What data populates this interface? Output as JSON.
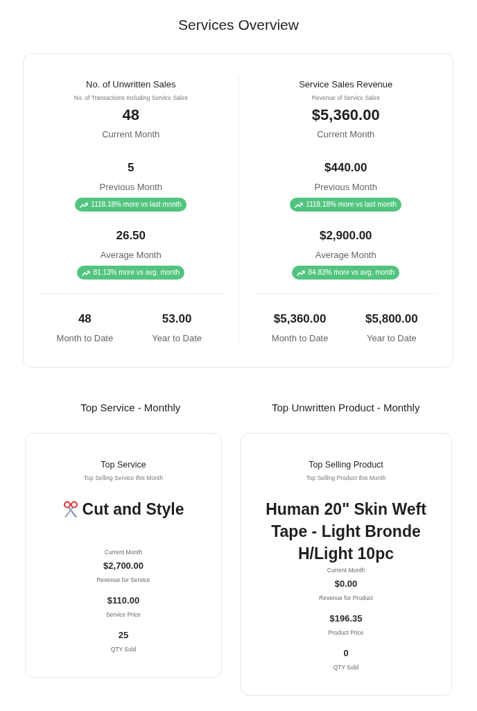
{
  "title": "Services Overview",
  "overview": {
    "panels": [
      {
        "title": "No. of Unwritten Sales",
        "subtitle": "No. of Transactions Including Service Sales",
        "current": {
          "value": "48",
          "label": "Current Month"
        },
        "comparisons": [
          {
            "value": "5",
            "label": "Previous Month",
            "badge": {
              "text": "1118.18% more vs last month",
              "rising": true
            }
          },
          {
            "value": "26.50",
            "label": "Average Month",
            "badge": {
              "text": "81.13% more vs avg. month",
              "rising": true
            }
          }
        ],
        "totals": [
          {
            "value": "48",
            "label": "Month to Date"
          },
          {
            "value": "53.00",
            "label": "Year to Date"
          }
        ]
      },
      {
        "title": "Service Sales Revenue",
        "subtitle": "Revenue of Service Sales",
        "current": {
          "value": "$5,360.00",
          "label": "Current Month"
        },
        "comparisons": [
          {
            "value": "$440.00",
            "label": "Previous Month",
            "badge": {
              "text": "1118.18% more vs last month",
              "rising": true
            }
          },
          {
            "value": "$2,900.00",
            "label": "Average Month",
            "badge": {
              "text": "84.83% more vs avg. month",
              "rising": true
            }
          }
        ],
        "totals": [
          {
            "value": "$5,360.00",
            "label": "Month to Date"
          },
          {
            "value": "$5,800.00",
            "label": "Year to Date"
          }
        ]
      }
    ]
  },
  "top_sections": [
    {
      "heading": "Top Service - Monthly",
      "card": {
        "kind": "service",
        "title": "Top Service",
        "subtitle": "Top Selling Service this Month",
        "name": "Cut and Style",
        "period": "Current Month",
        "stats": [
          {
            "value": "$2,700.00",
            "label": "Revenue for Service"
          },
          {
            "value": "$110.00",
            "label": "Service Price"
          },
          {
            "value": "25",
            "label": "QTY Sold"
          }
        ]
      }
    },
    {
      "heading": "Top Unwritten Product - Monthly",
      "card": {
        "kind": "product",
        "title": "Top Selling Product",
        "subtitle": "Top Selling Product this Month",
        "name": "Human 20\" Skin Weft Tape - Light Bronde H/Light 10pc",
        "period": "Current Month",
        "stats": [
          {
            "value": "$0.00",
            "label": "Revenue for Product"
          },
          {
            "value": "$196.35",
            "label": "Product Price"
          },
          {
            "value": "0",
            "label": "QTY Sold"
          }
        ]
      }
    }
  ]
}
